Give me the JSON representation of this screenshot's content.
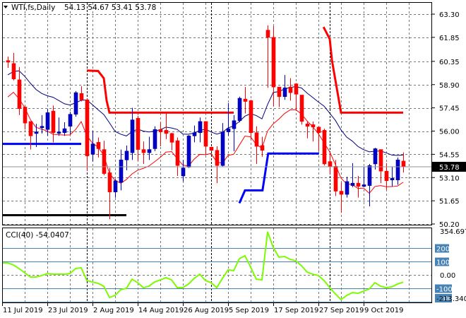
{
  "header": {
    "symbol": "WTI,fs,Daily",
    "ohlc": "54.13 54.67 53.41 53.78"
  },
  "price_axis": {
    "labels": [
      "63.30",
      "61.85",
      "60.35",
      "58.90",
      "57.45",
      "56.00",
      "54.55",
      "53.10",
      "51.65",
      "50.20"
    ],
    "values": [
      63.3,
      61.85,
      60.35,
      58.9,
      57.45,
      56.0,
      54.55,
      53.1,
      51.65,
      50.2
    ],
    "current": "53.78",
    "current_value": 53.78
  },
  "cci": {
    "title": "CCI(40) -54.0407",
    "max_label": "354.6973",
    "min_label": "-213.340",
    "max": 354.6973,
    "min": -213.34,
    "levels": [
      {
        "v": 200,
        "label": "200"
      },
      {
        "v": 100,
        "label": "100"
      },
      {
        "v": -100,
        "label": "-100"
      },
      {
        "v": -200,
        "label": "-200"
      }
    ],
    "zero_label": "0.00"
  },
  "date_axis": [
    "11 Jul 2019",
    "23 Jul 2019",
    "2 Aug 2019",
    "14 Aug 2019",
    "26 Aug 2019",
    "5 Sep 2019",
    "17 Sep 2019",
    "27 Sep 2019",
    "9 Oct 2019"
  ],
  "colors": {
    "bull": "#0000cc",
    "bear": "#ff0000",
    "cci": "#7cfc00",
    "level": "#4682b4",
    "grid": "#777777",
    "ma_slow": "#000080",
    "ma_fast": "#ff0000",
    "step_blue": "#0000ff",
    "step_red": "#ff0000"
  },
  "chart_data": {
    "type": "candlestick",
    "title": "WTI,fs,Daily",
    "ylim": [
      50.2,
      63.3
    ],
    "ohlc": [
      [
        60.4,
        60.65,
        59.95,
        60.3
      ],
      [
        60.22,
        60.88,
        59.16,
        59.25
      ],
      [
        59.2,
        60.0,
        57.0,
        57.4
      ],
      [
        57.5,
        57.55,
        56.1,
        56.5
      ],
      [
        56.6,
        56.6,
        54.85,
        55.7
      ],
      [
        55.85,
        56.45,
        55.0,
        55.95
      ],
      [
        56.25,
        57.0,
        55.85,
        56.3
      ],
      [
        56.1,
        57.4,
        55.7,
        57.15
      ],
      [
        57.25,
        57.6,
        55.3,
        55.9
      ],
      [
        55.9,
        56.85,
        55.7,
        55.95
      ],
      [
        55.9,
        56.55,
        55.7,
        56.15
      ],
      [
        56.3,
        57.2,
        55.8,
        57.05
      ],
      [
        57.05,
        58.5,
        56.9,
        58.4
      ],
      [
        58.35,
        58.8,
        57.85,
        57.95
      ],
      [
        57.95,
        58.05,
        53.5,
        54.45
      ],
      [
        54.55,
        56.0,
        54.1,
        55.2
      ],
      [
        55.3,
        55.6,
        54.35,
        54.9
      ],
      [
        54.85,
        55.4,
        53.25,
        53.35
      ],
      [
        53.4,
        53.7,
        50.5,
        52.2
      ],
      [
        52.2,
        53.0,
        51.85,
        52.9
      ],
      [
        52.8,
        54.85,
        52.3,
        54.2
      ],
      [
        54.2,
        55.1,
        53.55,
        54.75
      ],
      [
        54.65,
        57.45,
        54.2,
        56.7
      ],
      [
        56.8,
        56.95,
        54.15,
        54.85
      ],
      [
        54.85,
        55.35,
        53.95,
        54.65
      ],
      [
        54.65,
        55.65,
        54.2,
        54.85
      ],
      [
        54.9,
        56.3,
        54.75,
        56.1
      ],
      [
        56.1,
        56.55,
        55.05,
        55.95
      ],
      [
        56.05,
        57.15,
        55.5,
        55.85
      ],
      [
        55.85,
        55.9,
        54.8,
        55.3
      ],
      [
        55.4,
        55.6,
        53.2,
        53.85
      ],
      [
        53.2,
        54.2,
        52.85,
        53.7
      ],
      [
        53.75,
        55.75,
        53.7,
        55.7
      ],
      [
        55.7,
        56.35,
        55.3,
        55.9
      ],
      [
        55.9,
        56.85,
        55.3,
        56.6
      ],
      [
        56.6,
        56.6,
        54.5,
        55.05
      ],
      [
        55.0,
        55.0,
        54.75,
        54.8
      ],
      [
        54.8,
        55.05,
        52.75,
        53.85
      ],
      [
        53.85,
        56.5,
        53.8,
        55.95
      ],
      [
        55.95,
        57.75,
        55.7,
        56.15
      ],
      [
        56.15,
        57.0,
        54.75,
        56.65
      ],
      [
        56.65,
        58.15,
        56.55,
        58.05
      ],
      [
        58.0,
        58.75,
        57.1,
        57.85
      ],
      [
        57.9,
        57.95,
        55.5,
        55.9
      ],
      [
        55.9,
        56.3,
        53.95,
        55.05
      ],
      [
        55.1,
        55.65,
        54.4,
        54.8
      ],
      [
        62.3,
        62.6,
        58.7,
        61.85
      ],
      [
        61.85,
        62.55,
        57.55,
        58.75
      ],
      [
        58.75,
        58.75,
        57.5,
        58.15
      ],
      [
        58.15,
        59.5,
        57.95,
        58.7
      ],
      [
        58.75,
        59.3,
        57.9,
        58.4
      ],
      [
        58.95,
        59.0,
        57.35,
        58.3
      ],
      [
        58.25,
        58.25,
        56.4,
        56.6
      ],
      [
        56.45,
        56.6,
        55.55,
        56.3
      ],
      [
        56.4,
        56.6,
        55.35,
        56.25
      ],
      [
        56.25,
        56.25,
        54.75,
        55.9
      ],
      [
        56.05,
        56.15,
        53.85,
        53.95
      ],
      [
        54.1,
        54.7,
        53.3,
        53.8
      ],
      [
        53.8,
        54.2,
        51.95,
        52.25
      ],
      [
        52.25,
        52.8,
        50.9,
        52.05
      ],
      [
        52.05,
        53.15,
        51.85,
        52.85
      ],
      [
        52.6,
        54.0,
        52.5,
        52.75
      ],
      [
        52.75,
        53.2,
        51.85,
        52.55
      ],
      [
        52.55,
        53.75,
        52.5,
        52.65
      ],
      [
        52.6,
        53.95,
        51.3,
        53.85
      ],
      [
        53.95,
        54.95,
        53.6,
        54.9
      ],
      [
        54.85,
        54.85,
        52.75,
        53.5
      ],
      [
        53.5,
        54.0,
        52.35,
        52.9
      ],
      [
        52.95,
        53.75,
        52.55,
        53.05
      ],
      [
        52.95,
        54.35,
        52.65,
        54.2
      ],
      [
        54.13,
        54.67,
        53.41,
        53.78
      ]
    ],
    "cci_values": [
      89,
      74,
      47,
      16,
      -16,
      -16,
      -5,
      10,
      5,
      5,
      5,
      10,
      47,
      53,
      -42,
      -53,
      -63,
      -84,
      -168,
      -153,
      -110,
      -100,
      -32,
      -58,
      -95,
      -84,
      -53,
      -37,
      -21,
      -37,
      -95,
      -95,
      -68,
      -26,
      5,
      -42,
      -58,
      -95,
      -26,
      37,
      32,
      121,
      142,
      58,
      -32,
      -37,
      321,
      205,
      132,
      137,
      116,
      105,
      68,
      21,
      5,
      -5,
      -42,
      -95,
      -142,
      -184,
      -153,
      -132,
      -137,
      -121,
      -105,
      -58,
      -84,
      -95,
      -89,
      -68,
      -54
    ],
    "step_lines": [
      {
        "color": "step_blue",
        "points": [
          [
            -1,
            55.2
          ],
          [
            13,
            55.2
          ]
        ]
      },
      {
        "color": "step_black",
        "points": [
          [
            -1,
            50.75
          ],
          [
            21,
            50.75
          ]
        ]
      },
      {
        "color": "step_red",
        "points": [
          [
            14,
            59.78
          ],
          [
            16,
            59.75
          ],
          [
            17,
            59.3
          ],
          [
            17.5,
            57.9
          ],
          [
            18,
            57.15
          ],
          [
            40,
            57.15
          ]
        ]
      },
      {
        "color": "step_blue",
        "points": [
          [
            41,
            51.5
          ],
          [
            42,
            52.3
          ],
          [
            45.1,
            52.3
          ],
          [
            46.1,
            54.6
          ],
          [
            55.1,
            54.6
          ]
        ]
      },
      {
        "color": "step_red",
        "points": [
          [
            55.9,
            62.5
          ],
          [
            57,
            61.75
          ],
          [
            57.4,
            60.4
          ],
          [
            59,
            57.15
          ],
          [
            70,
            57.15
          ]
        ]
      }
    ],
    "period_separators": [
      14,
      36,
      57
    ]
  }
}
